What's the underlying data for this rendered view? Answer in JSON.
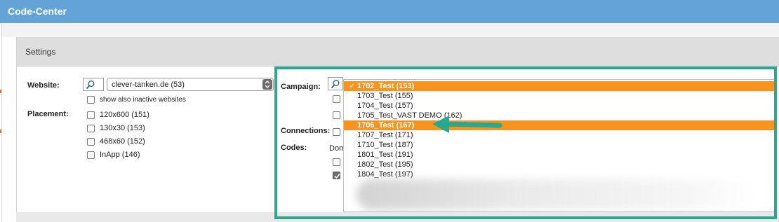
{
  "app": {
    "title": "Code-Center"
  },
  "settings": {
    "header": "Settings"
  },
  "website": {
    "label": "Website:",
    "selected": "clever-tanken.de (53)",
    "show_inactive_label": "show also inactive websites"
  },
  "placement": {
    "label": "Placement:",
    "items": [
      {
        "label": "120x600 (151)"
      },
      {
        "label": "130x30 (153)"
      },
      {
        "label": "468x60 (152)"
      },
      {
        "label": "InApp (146)"
      }
    ]
  },
  "campaign": {
    "label": "Campaign:",
    "options": [
      {
        "label": "1702_Test (153)",
        "state": "selected"
      },
      {
        "label": "1703_Test (155)",
        "state": "normal"
      },
      {
        "label": "1704_Test (157)",
        "state": "normal"
      },
      {
        "label": "1705_Test_VAST DEMO (162)",
        "state": "normal"
      },
      {
        "label": "1706_Test (167)",
        "state": "highlighted"
      },
      {
        "label": "1707_Test (171)",
        "state": "normal"
      },
      {
        "label": "1710_Test (187)",
        "state": "normal"
      },
      {
        "label": "1801_Test (191)",
        "state": "normal"
      },
      {
        "label": "1802_Test (195)",
        "state": "normal"
      },
      {
        "label": "1804_Test (197)",
        "state": "normal"
      }
    ]
  },
  "connections": {
    "label": "Connections:"
  },
  "codes": {
    "label": "Codes:",
    "partial": "Dom"
  },
  "colors": {
    "titlebar": "#63a3d8",
    "selection": "#f7931e",
    "annotation": "#28a88e"
  },
  "icons": {
    "search": "search-icon",
    "dropdown": "chevron-updown-icon",
    "check": "checkmark-icon",
    "annotation": "arrow-left-icon"
  }
}
